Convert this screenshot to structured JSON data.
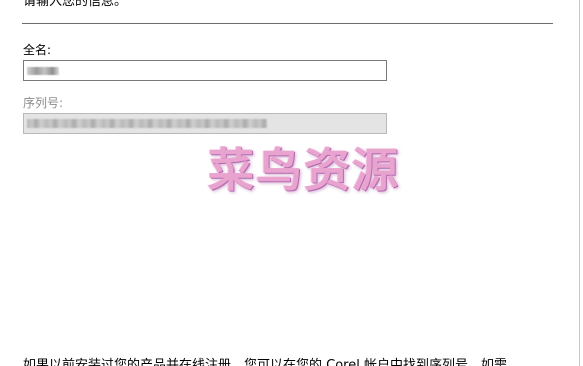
{
  "form": {
    "instruction": "请输入您的信息。",
    "full_name": {
      "label": "全名:",
      "value": ""
    },
    "serial_number": {
      "label": "序列号:",
      "value": ""
    }
  },
  "watermark": {
    "text": "菜鸟资源",
    "color": "#e9a3cf"
  },
  "footer": {
    "text": "如果以前安装过您的产品并在线注册，您可以在您的 Corel 帐户中找到序列号。如需"
  }
}
